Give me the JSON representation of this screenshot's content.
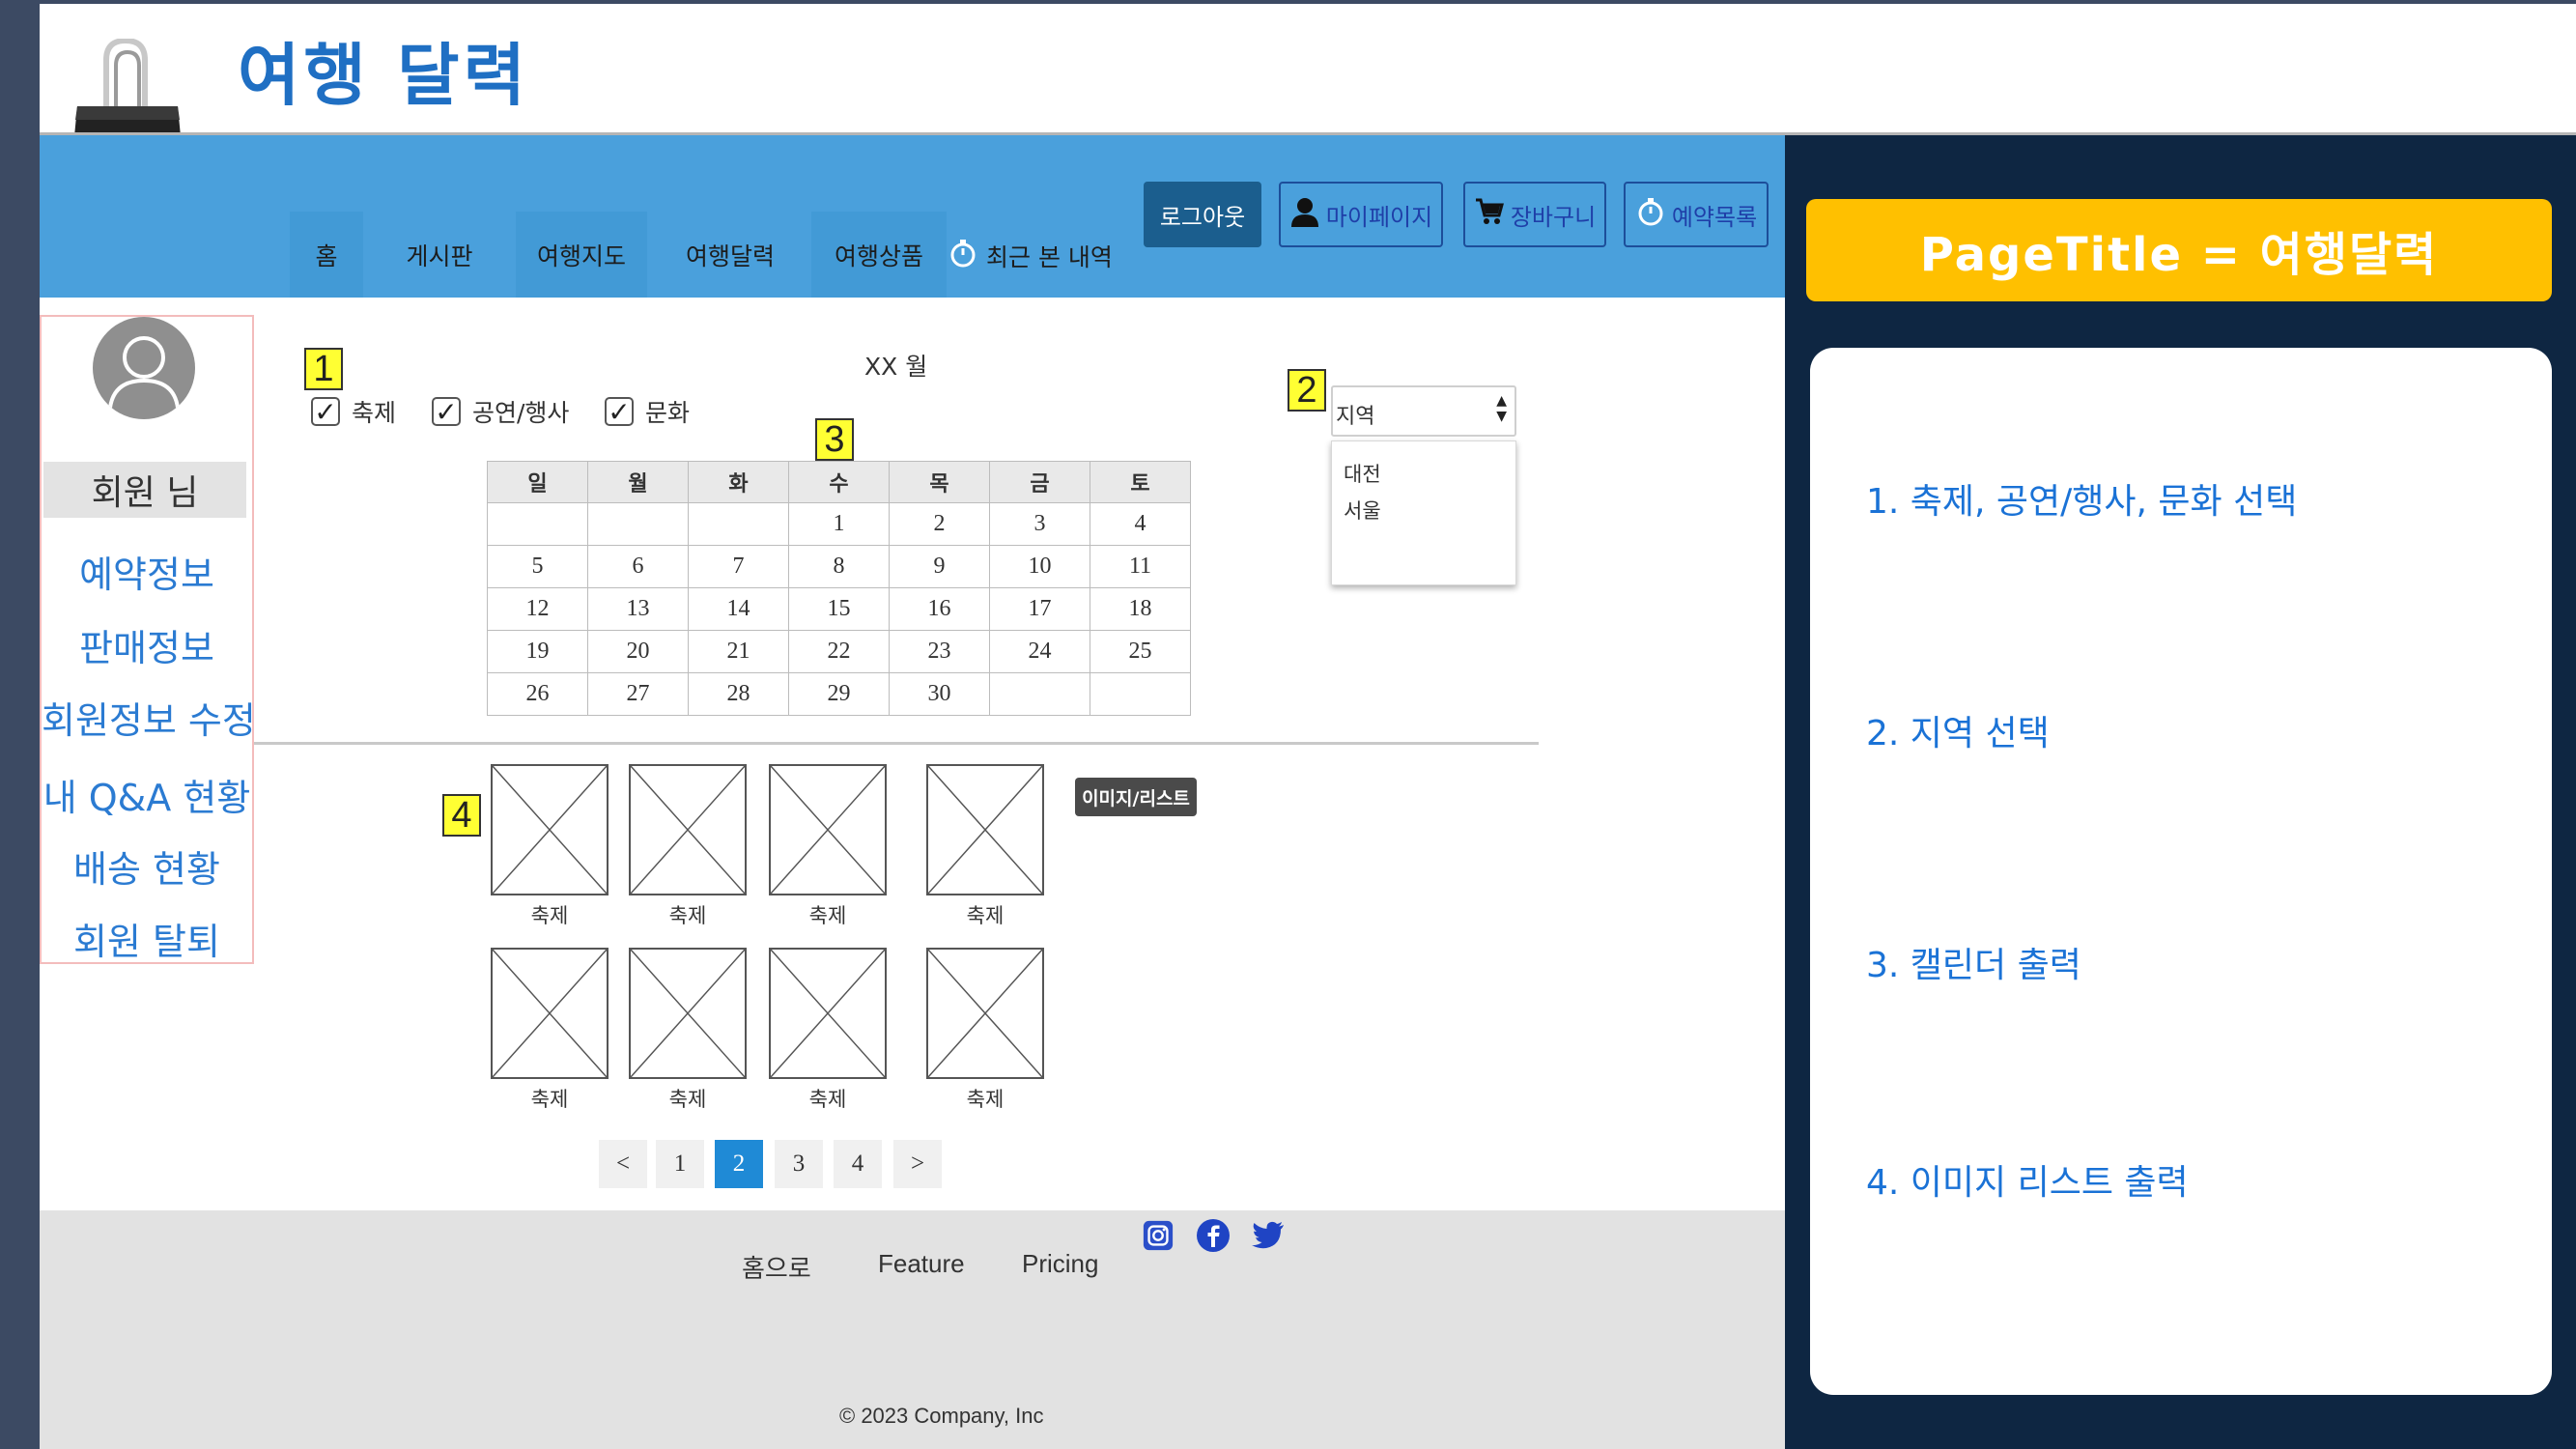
{
  "slide": {
    "title": "여행 달력",
    "icon": "binder-clip-icon"
  },
  "nav": {
    "tabs": [
      {
        "label": "홈"
      },
      {
        "label": "게시판"
      },
      {
        "label": "여행지도"
      },
      {
        "label": "여행달력"
      },
      {
        "label": "여행상품"
      }
    ],
    "recent_label": "최근 본 내역",
    "logout_label": "로그아웃",
    "mypage_label": "마이페이지",
    "cart_label": "장바구니",
    "reservations_label": "예약목록",
    "colors": {
      "bar": "#4aa0dc",
      "logout": "#1b5e8e"
    }
  },
  "sidebar": {
    "member_name": "회원 님",
    "links": [
      {
        "label": "예약정보"
      },
      {
        "label": "판매정보"
      },
      {
        "label": "회원정보 수정"
      },
      {
        "label": "내 Q&A 현황"
      },
      {
        "label": "배송 현황"
      },
      {
        "label": "회원 탈퇴"
      }
    ]
  },
  "annotations": {
    "tag1": "1",
    "tag2": "2",
    "tag3": "3",
    "tag4": "4"
  },
  "filters": {
    "options": [
      {
        "label": "축제",
        "checked": true
      },
      {
        "label": "공연/행사",
        "checked": true
      },
      {
        "label": "문화",
        "checked": true
      }
    ]
  },
  "calendar": {
    "month_label": "XX 월",
    "weekdays": [
      "일",
      "월",
      "화",
      "수",
      "목",
      "금",
      "토"
    ],
    "weeks": [
      [
        "",
        "",
        "",
        "1",
        "2",
        "3",
        "4"
      ],
      [
        "5",
        "6",
        "7",
        "8",
        "9",
        "10",
        "11"
      ],
      [
        "12",
        "13",
        "14",
        "15",
        "16",
        "17",
        "18"
      ],
      [
        "19",
        "20",
        "21",
        "22",
        "23",
        "24",
        "25"
      ],
      [
        "26",
        "27",
        "28",
        "29",
        "30",
        "",
        ""
      ]
    ]
  },
  "region": {
    "placeholder": "지역",
    "options": [
      "대전",
      "서울"
    ]
  },
  "gallery": {
    "toggle_label": "이미지/리스트",
    "items": [
      {
        "caption": "축제"
      },
      {
        "caption": "축제"
      },
      {
        "caption": "축제"
      },
      {
        "caption": "축제"
      },
      {
        "caption": "축제"
      },
      {
        "caption": "축제"
      },
      {
        "caption": "축제"
      },
      {
        "caption": "축제"
      }
    ]
  },
  "pagination": {
    "prev": "<",
    "pages": [
      "1",
      "2",
      "3",
      "4"
    ],
    "current": "2",
    "next": ">"
  },
  "footer": {
    "links": [
      "홈으로",
      "Feature",
      "Pricing"
    ],
    "social_icons": [
      "instagram-icon",
      "facebook-icon",
      "twitter-icon"
    ],
    "copyright": "© 2023 Company, Inc"
  },
  "panel": {
    "title": "PageTitle = 여행달력",
    "items": [
      "1. 축제, 공연/행사, 문화 선택",
      "2. 지역 선택",
      "3. 캘린더 출력",
      "4. 이미지 리스트 출력"
    ],
    "colors": {
      "background": "#0e2642",
      "title_bg": "#ffc000",
      "item_text": "#1a72d6"
    }
  }
}
